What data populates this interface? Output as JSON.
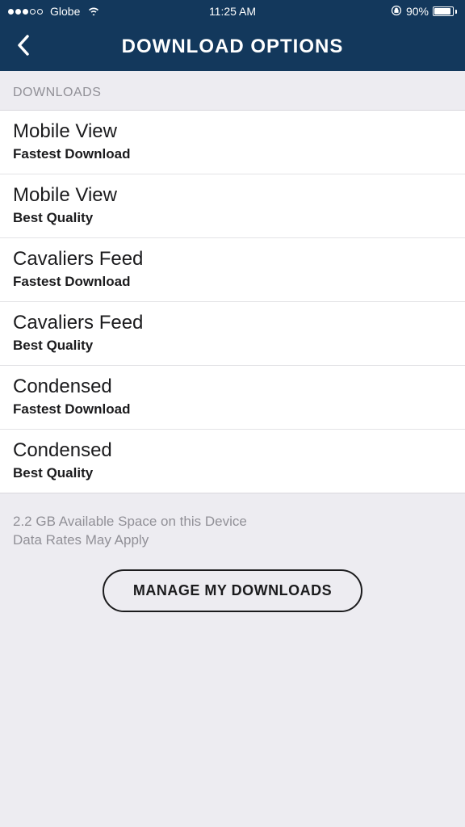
{
  "statusBar": {
    "carrier": "Globe",
    "time": "11:25 AM",
    "batteryPercent": "90%"
  },
  "navBar": {
    "title": "DOWNLOAD OPTIONS"
  },
  "sectionHeader": "DOWNLOADS",
  "items": [
    {
      "title": "Mobile View",
      "subtitle": "Fastest Download"
    },
    {
      "title": "Mobile View",
      "subtitle": "Best Quality"
    },
    {
      "title": "Cavaliers Feed",
      "subtitle": "Fastest Download"
    },
    {
      "title": "Cavaliers Feed",
      "subtitle": "Best Quality"
    },
    {
      "title": "Condensed",
      "subtitle": "Fastest Download"
    },
    {
      "title": "Condensed",
      "subtitle": "Best Quality"
    }
  ],
  "footer": {
    "line1": "2.2 GB Available Space on this Device",
    "line2": "Data Rates May Apply",
    "buttonLabel": "MANAGE MY DOWNLOADS"
  }
}
